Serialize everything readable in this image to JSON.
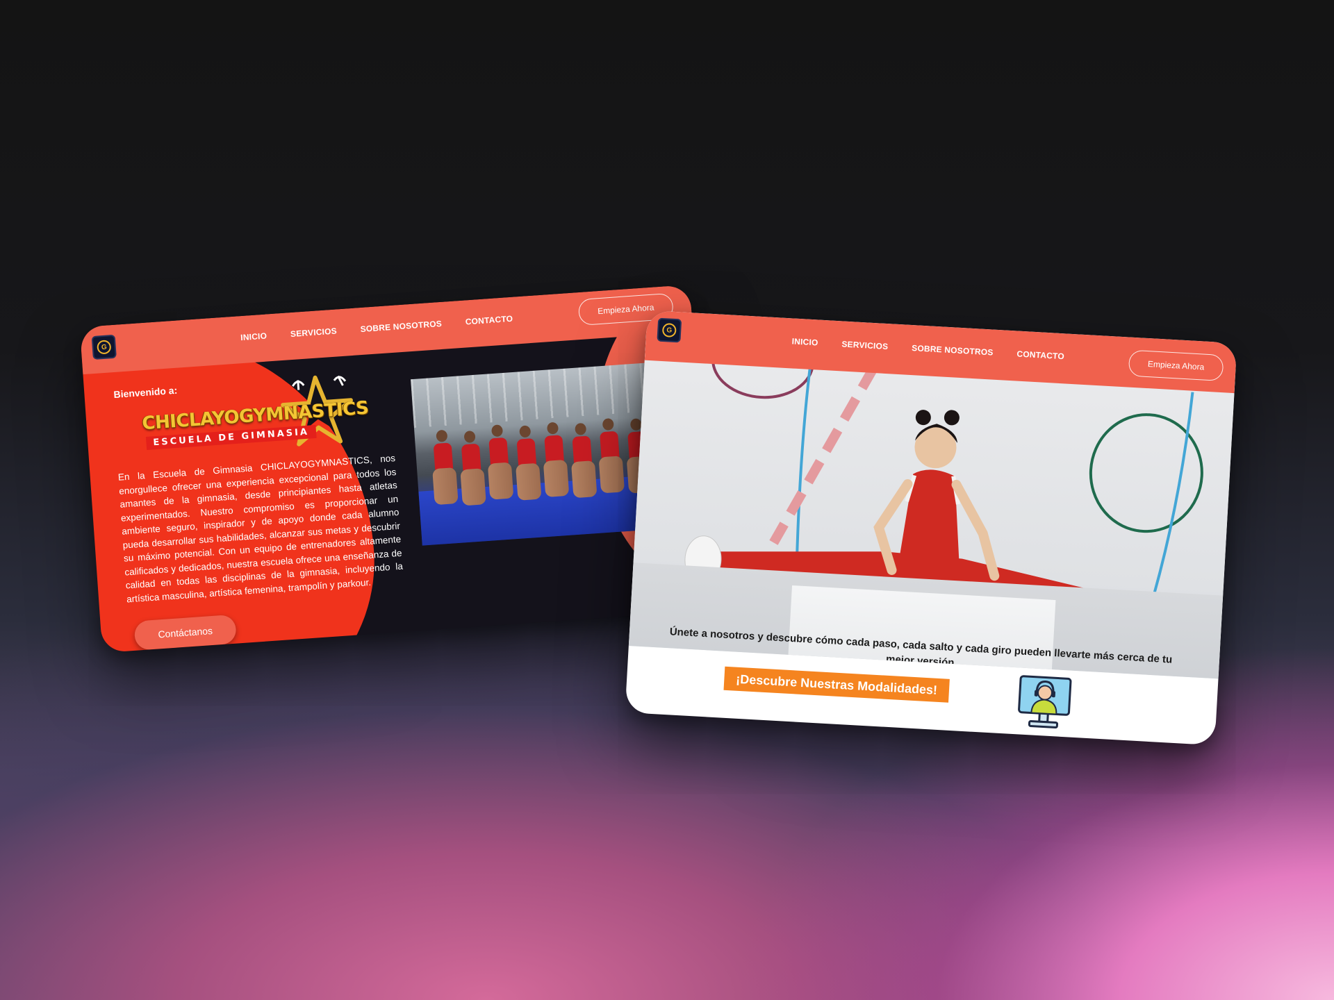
{
  "left_mockup": {
    "nav": {
      "items": [
        "INICIO",
        "SERVICIOS",
        "SOBRE NOSOTROS",
        "CONTACTO"
      ],
      "cta": "Empieza Ahora"
    },
    "welcome": "Bienvenido a:",
    "brand": {
      "name": "CHICLAYOGYMNASTICS",
      "subtitle": "ESCUELA DE GIMNASIA"
    },
    "intro": "En la Escuela de Gimnasia CHICLAYOGYMNASTICS, nos enorgullece ofrecer una experiencia excepcional para todos los amantes de la gimnasia, desde principiantes hasta atletas experimentados. Nuestro compromiso es proporcionar un ambiente seguro, inspirador y de apoyo donde cada alumno pueda desarrollar sus habilidades, alcanzar sus metas y descubrir su máximo potencial. Con un equipo de entrenadores altamente calificados y dedicados, nuestra escuela ofrece una enseñanza de calidad en todas las disciplinas de la gimnasia, incluyendo la artística masculina, artística femenina, trampolín y parkour.",
    "contact_button": "Contáctanos"
  },
  "right_mockup": {
    "nav": {
      "items": [
        "INICIO",
        "SERVICIOS",
        "SOBRE NOSOTROS",
        "CONTACTO"
      ],
      "cta": "Empieza Ahora"
    },
    "hero_caption": "Únete a nosotros y descubre cómo cada paso, cada salto y cada giro pueden llevarte más cerca de tu mejor versión",
    "modalities_button": "¡Descubre Nuestras Modalidades!"
  },
  "colors": {
    "nav_coral": "#f0614d",
    "hero_red": "#f0331c",
    "cta_orange": "#f5841f",
    "dark_bg": "#14121b",
    "brand_gold": "#f4c534"
  },
  "icons": [
    "logo-icon",
    "gold-star-icon",
    "support-agent-monitor-icon"
  ]
}
